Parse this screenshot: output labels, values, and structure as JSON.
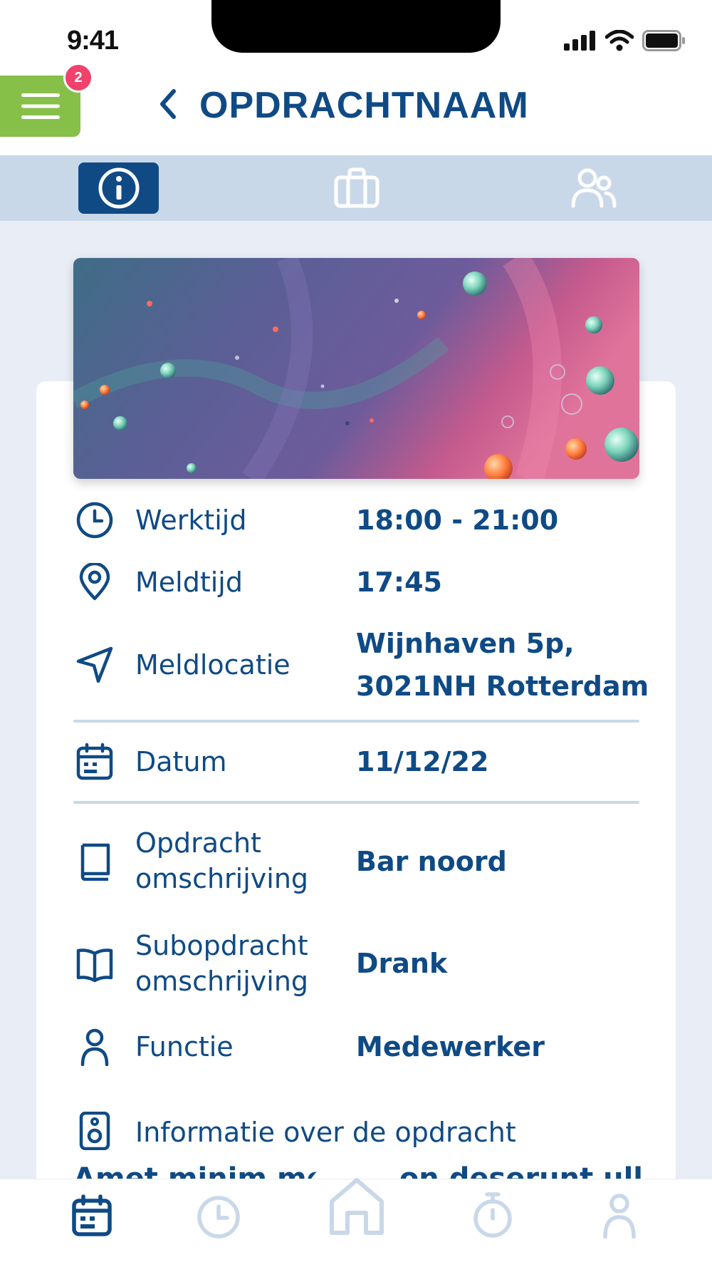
{
  "status": {
    "time": "9:41"
  },
  "header": {
    "title": "OPDRACHTNAAM",
    "menu_badge": "2"
  },
  "tabs": [
    {
      "icon": "info-icon",
      "active": true
    },
    {
      "icon": "briefcase-icon",
      "active": false
    },
    {
      "icon": "users-icon",
      "active": false
    }
  ],
  "details": {
    "werktijd_label": "Werktijd",
    "werktijd_value": "18:00 - 21:00",
    "meldtijd_label": "Meldtijd",
    "meldtijd_value": "17:45",
    "meldlocatie_label": "Meldlocatie",
    "meldlocatie_value_line1": "Wijnhaven 5p,",
    "meldlocatie_value_line2": "3021NH Rotterdam",
    "datum_label": "Datum",
    "datum_value": "11/12/22",
    "opdracht_label_line1": "Opdracht",
    "opdracht_label_line2": "omschrijving",
    "opdracht_value": "Bar noord",
    "subopdracht_label_line1": "Subopdracht",
    "subopdracht_label_line2": "omschrijving",
    "subopdracht_value": "Drank",
    "functie_label": "Functie",
    "functie_value": "Medewerker",
    "info_label": "Informatie over de opdracht",
    "info_text": "Amet minim mollit non deserunt ullamco"
  },
  "bottom_nav": [
    {
      "icon": "calendar-icon",
      "active": true
    },
    {
      "icon": "clock-icon",
      "active": false
    },
    {
      "icon": "home-icon",
      "active": false
    },
    {
      "icon": "stopwatch-icon",
      "active": false
    },
    {
      "icon": "profile-icon",
      "active": false
    }
  ],
  "colors": {
    "primary": "#0f4a85",
    "accent_green": "#86c049",
    "badge": "#f0426a",
    "tabbar_bg": "#c9d8e9",
    "page_bg": "#e8edf6",
    "inactive_icon": "#c9d8e9"
  }
}
